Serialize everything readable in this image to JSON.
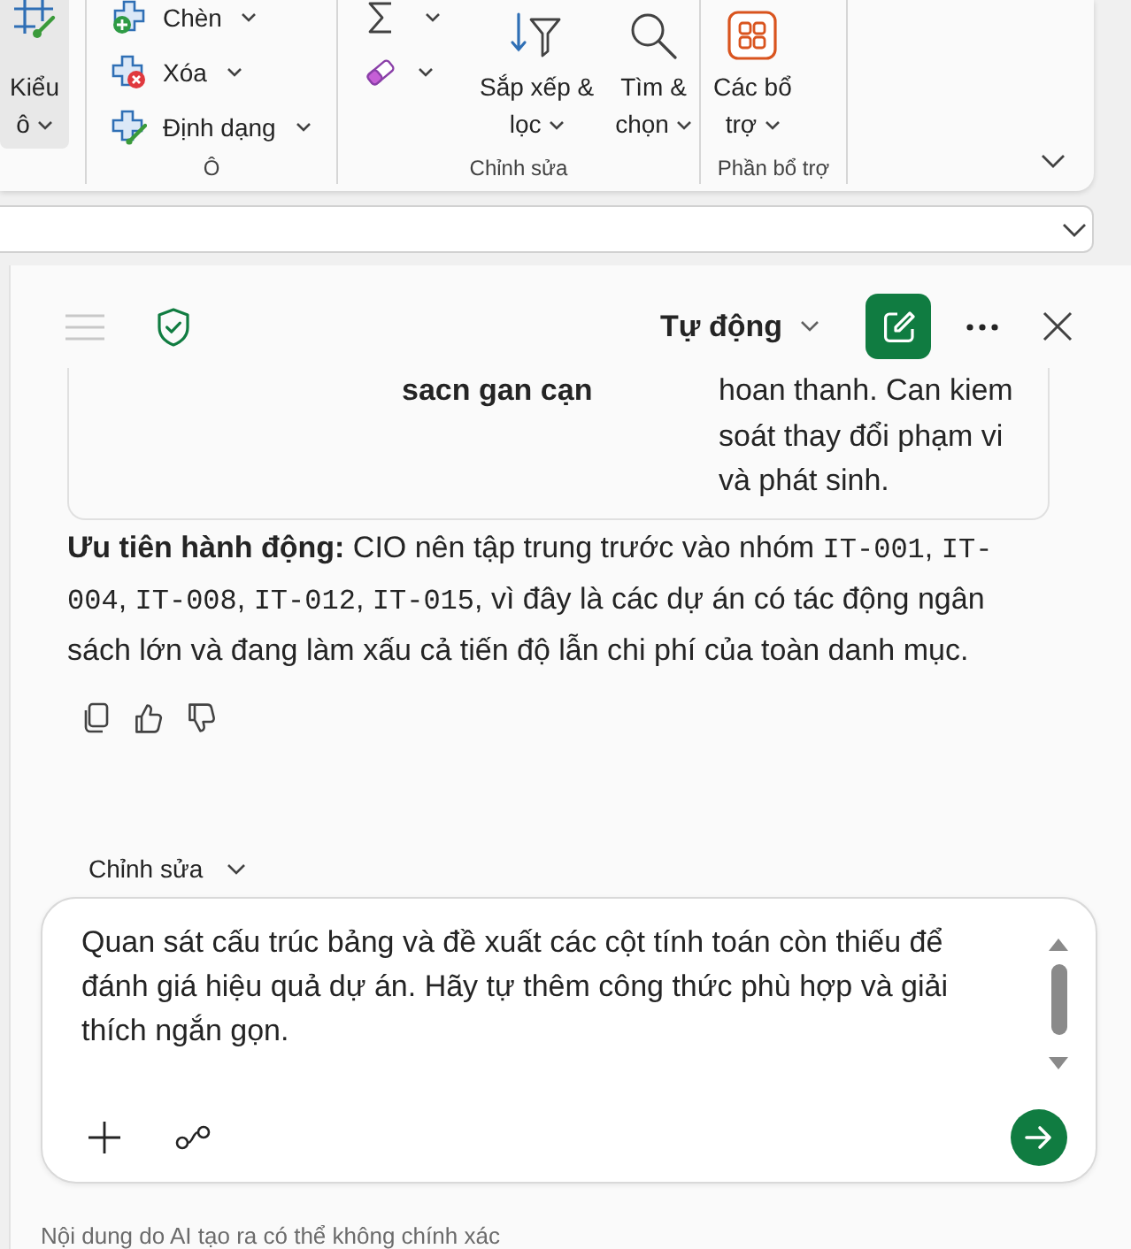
{
  "ribbon": {
    "groups": [
      {
        "columns": [
          [
            {
              "kind": "style",
              "lines": [
                "Kiểu",
                "ô"
              ],
              "selected": true
            }
          ]
        ]
      },
      {
        "label": "Ô",
        "columns": [
          [
            {
              "kind": "insert",
              "lines": [
                "Chèn"
              ],
              "selected": false
            },
            {
              "kind": "delete",
              "lines": [
                "Xóa"
              ],
              "selected": false
            },
            {
              "kind": "format",
              "lines": [
                "Định dạng"
              ],
              "selected": false
            }
          ]
        ]
      },
      {
        "label": "Chỉnh sửa",
        "columns": [
          [
            {
              "kind": "sum",
              "selected": false
            },
            {
              "kind": "clear",
              "selected": false
            }
          ],
          [
            {
              "kind": "sort",
              "lines": [
                "Sắp xếp &",
                "lọc"
              ],
              "selected": false
            }
          ],
          [
            {
              "kind": "find",
              "lines": [
                "Tìm &",
                "chọn"
              ],
              "selected": false
            }
          ]
        ]
      },
      {
        "label": "Phần bổ trợ",
        "columns": [
          [
            {
              "kind": "addins",
              "lines": [
                "Các bổ",
                "trợ"
              ],
              "selected": false
            }
          ]
        ]
      }
    ]
  },
  "pane": {
    "header": {
      "menu_button": {
        "disabled": true
      },
      "mode": "Tự động"
    },
    "table_card": {
      "column_2": "sacn gan cạn",
      "column_3": "hoan thanh. Can kiem soát thay đổi phạm vi và phát sinh."
    },
    "message": {
      "segments": [
        {
          "kind": "text",
          "text": "**Ưu tiên hành động:** CIO nên tập trung trước vào nhóm "
        },
        {
          "kind": "code",
          "text": "IT-001"
        },
        {
          "kind": "text",
          "text": ", "
        },
        {
          "kind": "code",
          "text": "IT-004"
        },
        {
          "kind": "text",
          "text": ", "
        },
        {
          "kind": "code",
          "text": "IT-008"
        },
        {
          "kind": "text",
          "text": ", "
        },
        {
          "kind": "code",
          "text": "IT-012"
        },
        {
          "kind": "text",
          "text": ", "
        },
        {
          "kind": "code",
          "text": "IT-015"
        },
        {
          "kind": "text",
          "text": ", vì đây là các dự án có tác động ngân sách lớn và đang làm xấu cả tiến độ lẫn chi phí của toàn danh mục."
        }
      ]
    },
    "composer": {
      "mode": "Chỉnh sửa",
      "value": "Quan sát cấu trúc bảng và đề xuất các cột tính toán còn thiếu để đánh giá hiệu quả dự án. Hãy tự thêm công thức phù hợp và giải thích ngắn gọn."
    },
    "disclaimer": "Nội dung do AI tạo ra có thể không chính xác"
  }
}
